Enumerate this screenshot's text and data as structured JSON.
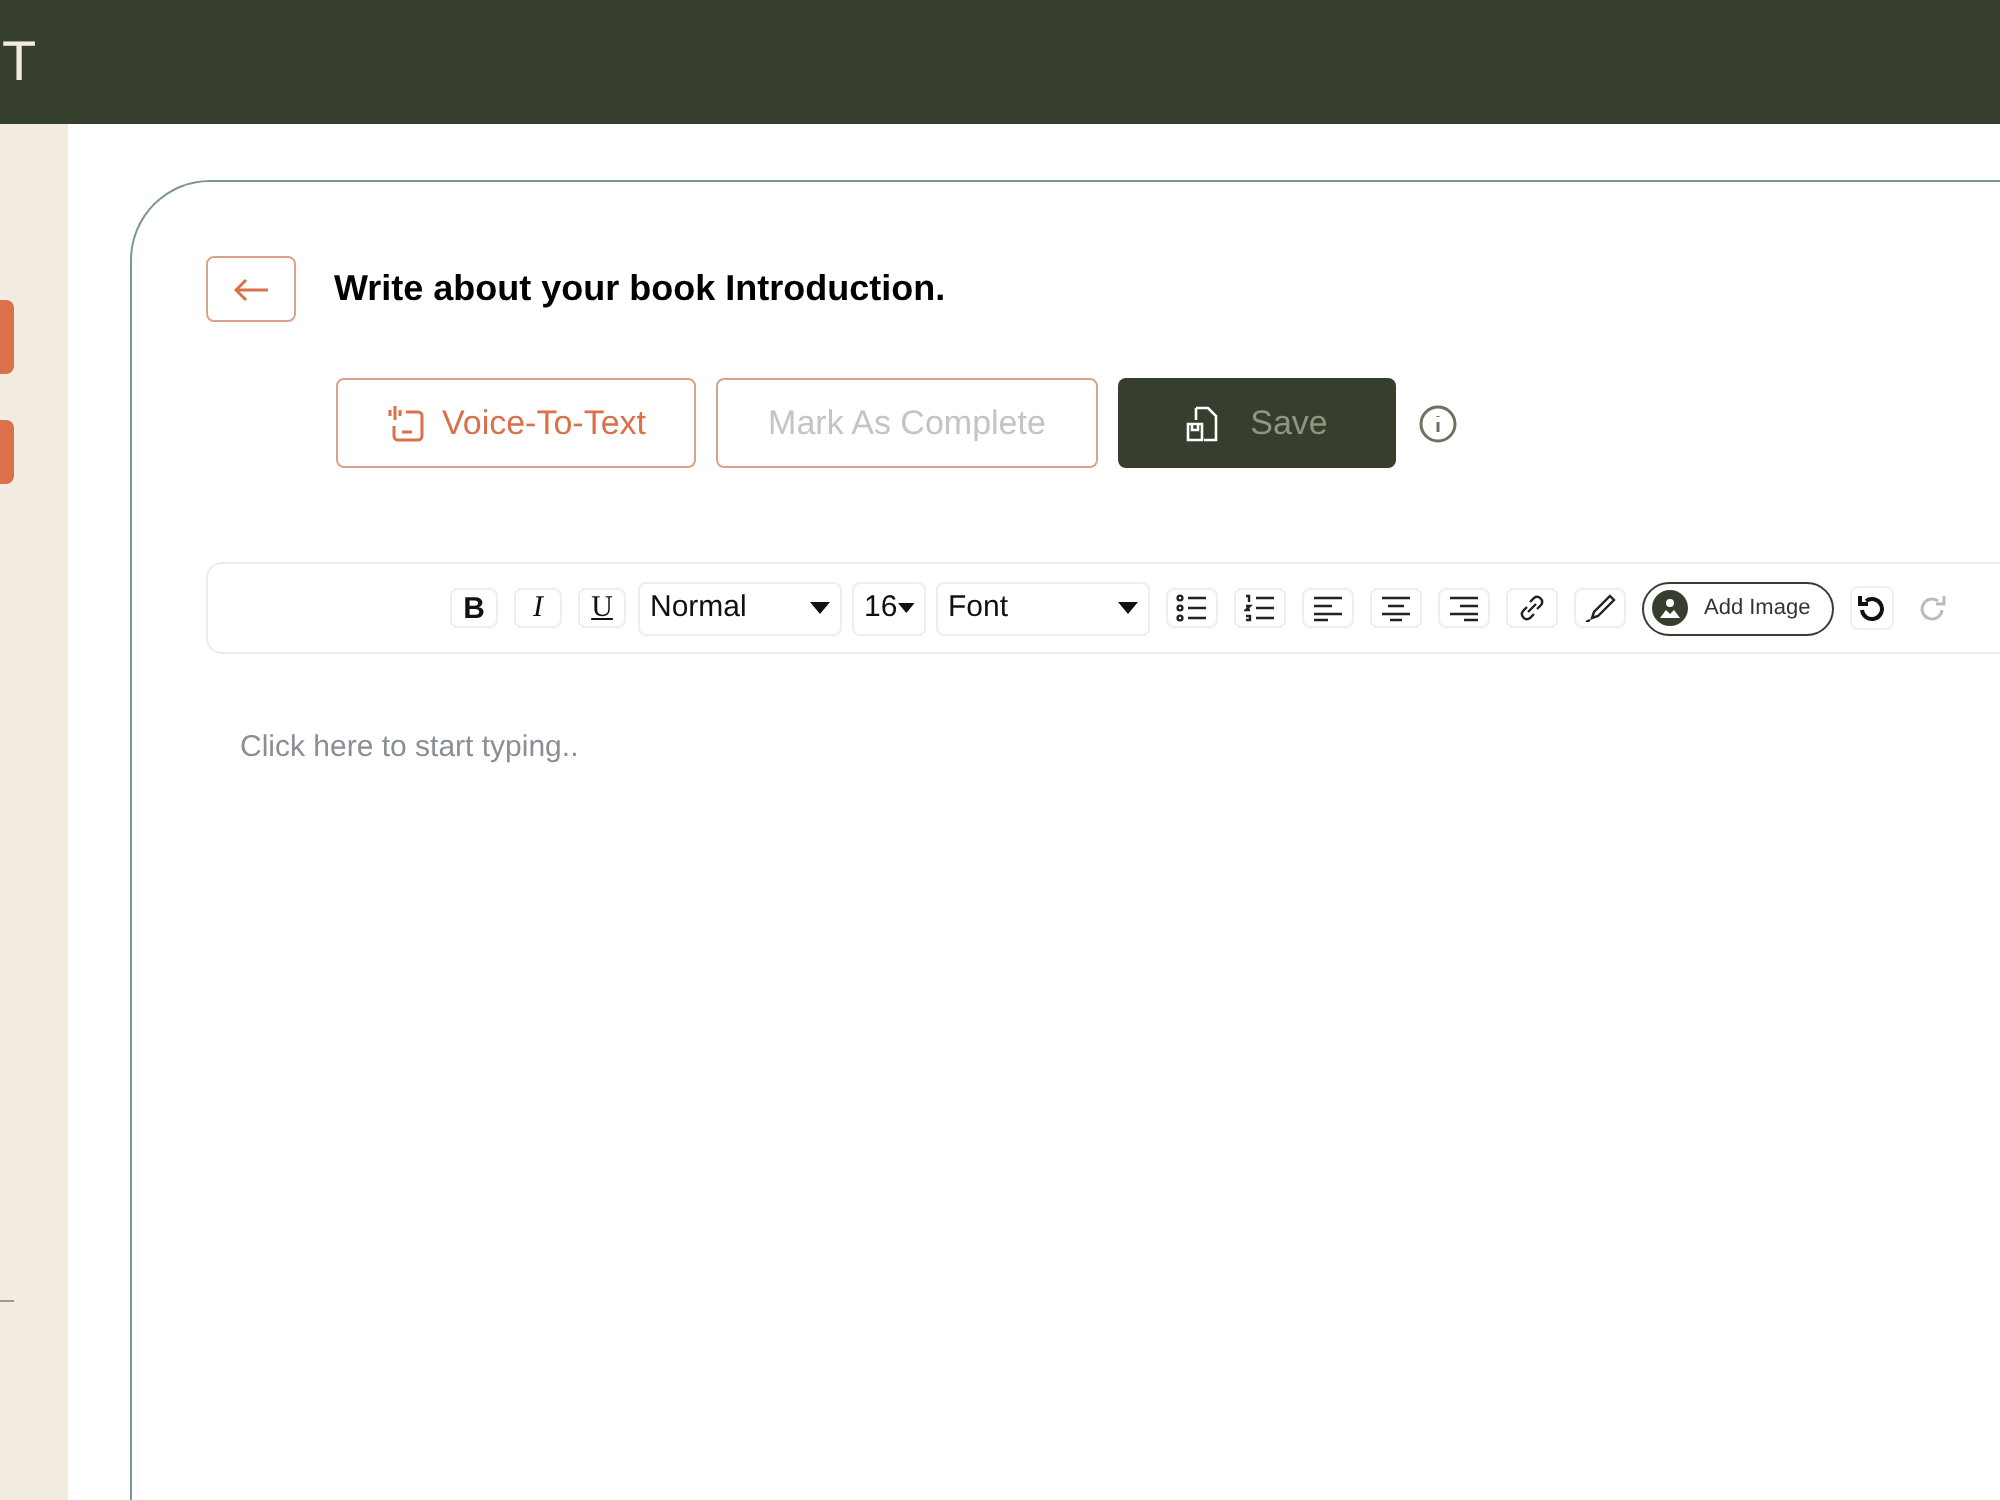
{
  "header": {
    "title": "T"
  },
  "sidebar": {
    "tabs": [
      {
        "selected": false
      },
      {
        "selected": false
      }
    ]
  },
  "editor": {
    "title": "Write about your book Introduction.",
    "actions": [
      {
        "kind": "voice",
        "label": "Voice-To-Text",
        "disabled": false
      },
      {
        "kind": "complete",
        "label": "Mark As Complete",
        "disabled": true
      },
      {
        "kind": "save",
        "label": "Save",
        "disabled": true
      }
    ],
    "toolbar": {
      "format_buttons": [
        "B",
        "I",
        "U"
      ],
      "selects": [
        {
          "kind": "style",
          "value": "Normal"
        },
        {
          "kind": "size",
          "value": "16"
        },
        {
          "kind": "font",
          "value": "Font"
        }
      ],
      "add_image": "Add Image",
      "undo_disabled": false,
      "redo_disabled": true
    },
    "placeholder": "Click here to start typing.."
  }
}
